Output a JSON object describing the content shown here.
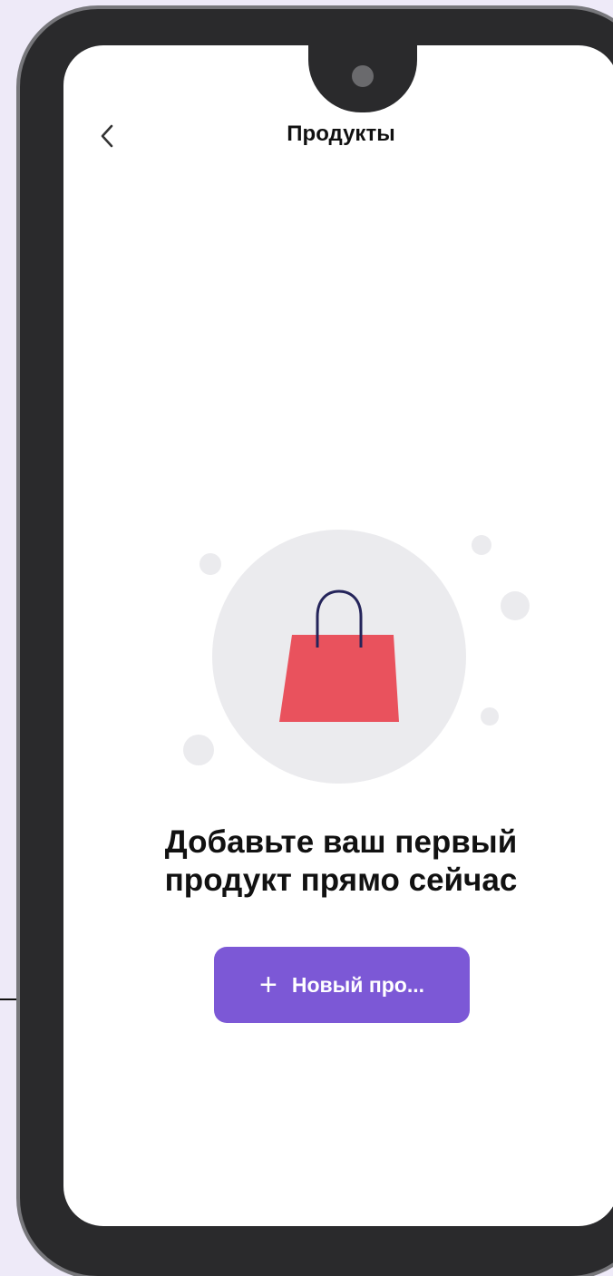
{
  "header": {
    "title": "Продукты",
    "back_icon": "chevron-left-icon"
  },
  "empty_state": {
    "message_line1": "Добавьте ваш первый",
    "message_line2": "продукт прямо сейчас",
    "icon": "shopping-bag-icon",
    "bag_color": "#e9525d",
    "handle_color": "#24245a"
  },
  "action": {
    "button_label": "Новый про...",
    "plus_icon": "+",
    "button_color": "#7c58d6"
  }
}
